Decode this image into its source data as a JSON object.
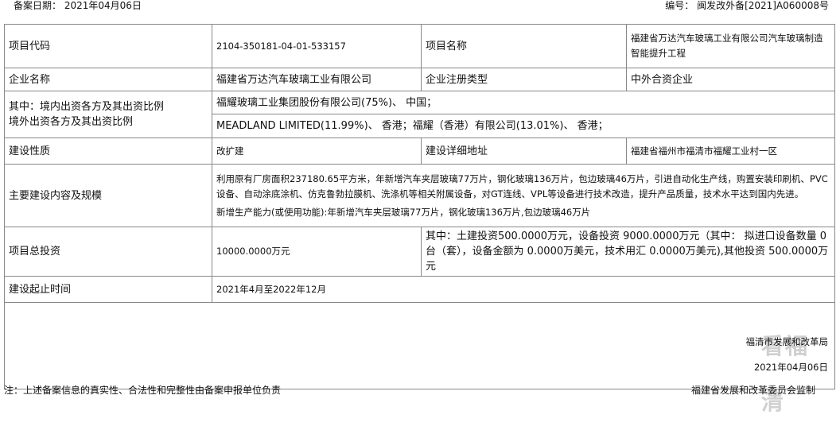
{
  "header": {
    "record_date": "备案日期： 2021年04月06日",
    "record_no": "编号： 闽发改外备[2021]A060008号"
  },
  "rows": {
    "code_label": "项目代码",
    "code_value": "2104-350181-04-01-533157",
    "name_label": "项目名称",
    "name_value": "福建省万达汽车玻璃工业有限公司汽车玻璃制造智能提升工程",
    "company_label": "企业名称",
    "company_value": "福建省万达汽车玻璃工业有限公司",
    "reg_type_label": "企业注册类型",
    "reg_type_value": "中外合资企业",
    "investor_label_1": "其中：境内出资各方及其出资比例",
    "investor_label_2": "境外出资各方及其出资比例",
    "domestic_investors": "福耀玻璃工业集团股份有限公司(75%)、 中国；",
    "foreign_investors": "MEADLAND LIMITED(11.99%)、 香港；福耀（香港）有限公司(13.01%)、 香港；",
    "nature_label": "建设性质",
    "nature_value": "改扩建",
    "address_label": "建设详细地址",
    "address_value": "福建省福州市福清市福耀工业村一区",
    "content_label": "主要建设内容及规模",
    "content_value": "利用原有厂房面积237180.65平方米，年新增汽车夹层玻璃77万片，钢化玻璃136万片，包边玻璃46万片，引进自动化生产线，购置安装印刷机、PVC设备、自动涂底涂机、仿克鲁勃拉膜机、洗涤机等相关附属设备，对GT连线、VPL等设备进行技术改造，提升产品质量，技术水平达到国内先进。",
    "capacity_value": "新增生产能力(或使用功能):年新增汽车夹层玻璃77万片，钢化玻璃136万片,包边玻璃46万片",
    "investment_label": "项目总投资",
    "investment_value": "10000.0000万元",
    "investment_detail": "其中：土建投资500.0000万元，设备投资 9000.0000万元（其中： 拟进口设备数量 0台（套），设备金额为 0.0000万美元，技术用汇 0.0000万美元),其他投资 500.0000万元",
    "period_label": "建设起止时间",
    "period_value": "2021年4月至2022年12月"
  },
  "signature": {
    "org": "福清市发展和改革局",
    "date": "2021年04月06日",
    "watermark": "看福清"
  },
  "footer": {
    "note": "注：上述备案信息的真实性、合法性和完整性由备案申报单位负责",
    "supervisor": "福建省发展和改革委员会监制"
  }
}
